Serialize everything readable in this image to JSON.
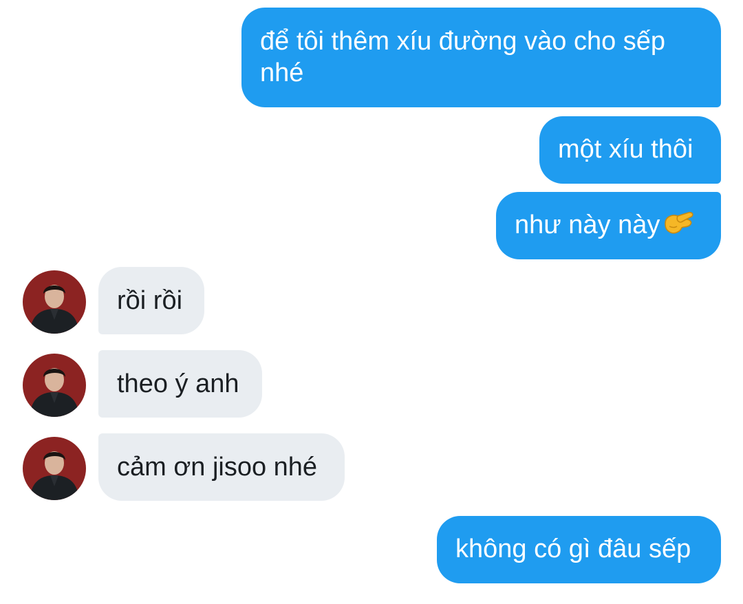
{
  "conversation": {
    "messages": [
      {
        "side": "outgoing",
        "text": "để tôi thêm xíu đường vào cho sếp nhé"
      },
      {
        "side": "outgoing",
        "text": "một xíu thôi"
      },
      {
        "side": "outgoing",
        "text": "như này này",
        "emoji": "pinching-hand-emoji"
      },
      {
        "side": "incoming",
        "text": "rồi rồi"
      },
      {
        "side": "incoming",
        "text": "theo ý anh"
      },
      {
        "side": "incoming",
        "text": "cảm ơn jisoo nhé"
      },
      {
        "side": "outgoing",
        "text": "không có gì đâu sếp"
      }
    ]
  },
  "theme": {
    "outgoing_bubble": "#1f9cf0",
    "incoming_bubble": "#e9edf1",
    "outgoing_text": "#ffffff",
    "incoming_text": "#1b1f23"
  }
}
